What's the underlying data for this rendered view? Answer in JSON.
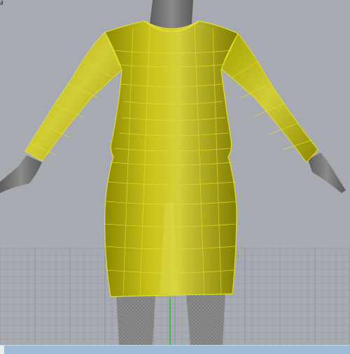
{
  "viewport": {
    "corner_glyph": "∂",
    "background_color": "#a7abb1",
    "grid_color": "#8f949a",
    "axis_y_color": "#22bb22",
    "garment_color": "#c9c400",
    "garment_line_color": "#e3de2a",
    "body_color": "#7a7a7a",
    "view": "perspective"
  }
}
